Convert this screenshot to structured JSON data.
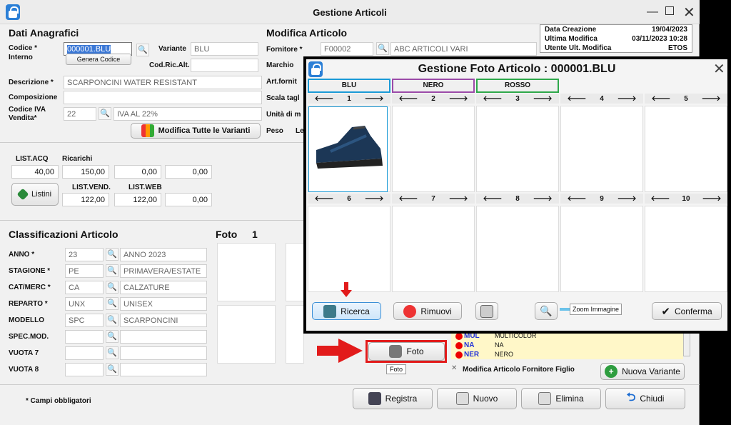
{
  "window": {
    "title": "Gestione Articoli"
  },
  "anag": {
    "title": "Dati Anagrafici",
    "codice_label": "Codice *",
    "interno_label": "Interno",
    "codice_value": "000001.BLU",
    "genera": "Genera Codice",
    "variante_label": "Variante",
    "variante_value": "BLU",
    "codric_label": "Cod.Ric.Alt.",
    "descr_label": "Descrizione *",
    "descr_value": "SCARPONCINI WATER RESISTANT",
    "compo_label": "Composizione",
    "iva_label": "Codice IVA",
    "iva_label2": "Vendita*",
    "iva_code": "22",
    "iva_desc": "IVA AL 22%",
    "modifica_varianti": "Modifica Tutte le Varianti"
  },
  "modifica": {
    "title": "Modifica Articolo",
    "fornitore_label": "Fornitore *",
    "fornitore_code": "F00002",
    "fornitore_name": "ABC ARTICOLI VARI",
    "marchio": "Marchio",
    "art_forn": "Art.fornit",
    "scala": "Scala tagl",
    "unita": "Unità di m",
    "peso": "Peso",
    "le": "Le"
  },
  "info": {
    "rows": [
      {
        "k": "Data Creazione",
        "v": "19/04/2023"
      },
      {
        "k": "Ultima Modifica",
        "v": "03/11/2023 10:28"
      },
      {
        "k": "Utente Ult. Modifica",
        "v": "ETOS"
      }
    ]
  },
  "prices": {
    "list_acq": "LIST.ACQ",
    "ricarichi": "Ricarichi",
    "acq": "40,00",
    "r1": "150,00",
    "r2": "0,00",
    "r3": "0,00",
    "listini": "Listini",
    "list_vend": "LIST.VEND.",
    "list_web": "LIST.WEB",
    "vend": "122,00",
    "web": "122,00",
    "v3": "0,00"
  },
  "classif": {
    "title": "Classificazioni Articolo",
    "rows": [
      {
        "label": "ANNO *",
        "code": "23",
        "desc": "ANNO 2023"
      },
      {
        "label": "STAGIONE *",
        "code": "PE",
        "desc": "PRIMAVERA/ESTATE"
      },
      {
        "label": "CAT/MERC *",
        "code": "CA",
        "desc": "CALZATURE"
      },
      {
        "label": "REPARTO *",
        "code": "UNX",
        "desc": "UNISEX"
      },
      {
        "label": "MODELLO",
        "code": "SPC",
        "desc": "SCARPONCINI"
      },
      {
        "label": "SPEC.MOD.",
        "code": "",
        "desc": ""
      },
      {
        "label": "VUOTA 7",
        "code": "",
        "desc": ""
      },
      {
        "label": "VUOTA 8",
        "code": "",
        "desc": ""
      }
    ]
  },
  "foto": {
    "title": "Foto",
    "num": "1",
    "btn": "Foto",
    "tooltip": "Foto"
  },
  "colors_list": [
    {
      "code": "MUL",
      "desc": "MULTICOLOR"
    },
    {
      "code": "NA",
      "desc": "NA"
    },
    {
      "code": "NER",
      "desc": "NERO"
    }
  ],
  "modifica_fornitore": "Modifica Articolo Fornitore Figlio",
  "nuova_variante": "Nuova Variante",
  "footer": {
    "note": "* Campi obbligatori",
    "registra": "Registra",
    "nuovo": "Nuovo",
    "elimina": "Elimina",
    "chiudi": "Chiudi"
  },
  "modal": {
    "title": "Gestione Foto Articolo : 000001.BLU",
    "tabs": [
      {
        "label": "BLU",
        "color": "#1a9ad6"
      },
      {
        "label": "NERO",
        "color": "#9b4aa8"
      },
      {
        "label": "ROSSO",
        "color": "#2ea84a"
      }
    ],
    "slots": [
      "1",
      "2",
      "3",
      "4",
      "5",
      "6",
      "7",
      "8",
      "9",
      "10"
    ],
    "ricerca": "Ricerca",
    "rimuovi": "Rimuovi",
    "zoom": "Zoom Immagine",
    "conferma": "Conferma"
  }
}
